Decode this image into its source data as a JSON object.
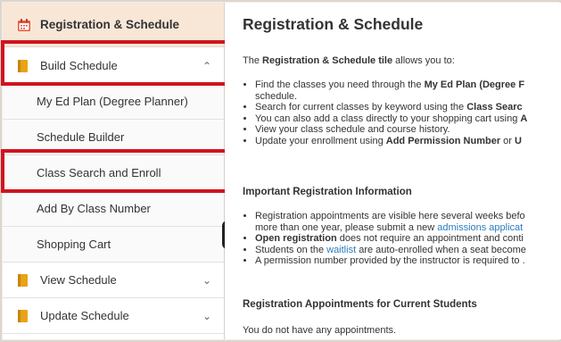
{
  "sidebar": {
    "header": "Registration & Schedule",
    "groups": {
      "build": "Build Schedule",
      "view": "View Schedule",
      "update": "Update Schedule"
    },
    "subitems": [
      "My Ed Plan (Degree Planner)",
      "Schedule Builder",
      "Class Search and Enroll",
      "Add By Class Number",
      "Shopping Cart"
    ]
  },
  "main": {
    "title": "Registration & Schedule",
    "intro": {
      "pre": "The ",
      "bold": "Registration & Schedule tile",
      "post": " allows you to:"
    },
    "bullets1": [
      {
        "pre": "Find the classes you need through the ",
        "bold": "My Ed Plan (Degree F"
      },
      {
        "pre": "schedule."
      },
      {
        "pre": "Search for current classes by keyword using the ",
        "bold": "Class Searc"
      },
      {
        "pre": "You can also add a class directly to your shopping cart using ",
        "bold": "A"
      },
      {
        "pre": "View your class schedule and course history."
      },
      {
        "pre": "Update your enrollment using ",
        "bold": "Add Permission Number",
        "post": " or ",
        "bold2": "U"
      }
    ],
    "important_heading": "Important Registration Information",
    "bullets2": [
      {
        "pre": "Registration appointments are visible here several weeks befo"
      },
      {
        "pre": "more than one year, please submit a new ",
        "link": "admissions applicat"
      },
      {
        "bold": "Open registration",
        "post": " does not require an appointment and conti"
      },
      {
        "pre": "Students on the ",
        "link": "waitlist",
        "post": " are auto-enrolled when a seat become"
      },
      {
        "pre": "A permission number provided by the instructor is required to ."
      }
    ],
    "appointments_heading": "Registration Appointments for Current Students",
    "no_appointments": "You do not have any appointments."
  },
  "colors": {
    "accent_red": "#d0141f",
    "header_bg": "#f8e7d7",
    "link": "#2a7bbf",
    "book_icon": "#e8a317"
  }
}
